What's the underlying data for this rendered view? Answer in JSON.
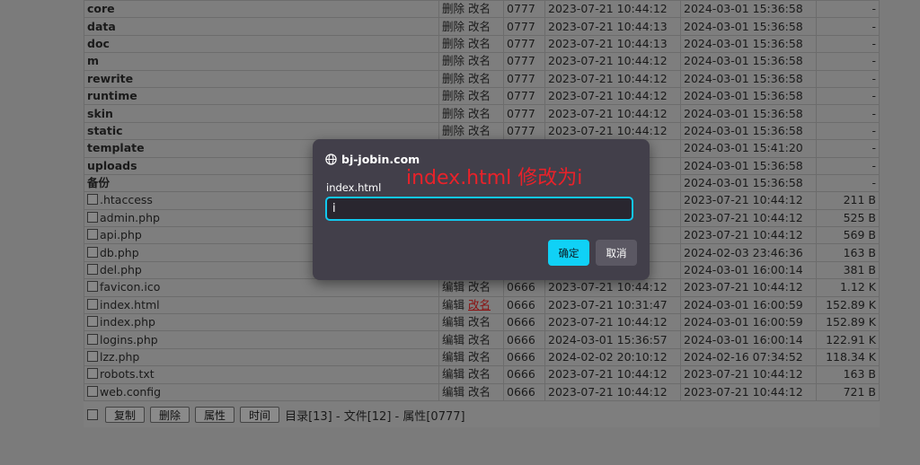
{
  "file_list": {
    "rows": [
      {
        "name": "core",
        "is_dir": true,
        "actions": [
          "删除",
          "改名"
        ],
        "perm": "0777",
        "created": "2023-07-21 10:44:12",
        "modified": "2024-03-01 15:36:58",
        "size": "-"
      },
      {
        "name": "data",
        "is_dir": true,
        "actions": [
          "删除",
          "改名"
        ],
        "perm": "0777",
        "created": "2023-07-21 10:44:13",
        "modified": "2024-03-01 15:36:58",
        "size": "-"
      },
      {
        "name": "doc",
        "is_dir": true,
        "actions": [
          "删除",
          "改名"
        ],
        "perm": "0777",
        "created": "2023-07-21 10:44:13",
        "modified": "2024-03-01 15:36:58",
        "size": "-"
      },
      {
        "name": "m",
        "is_dir": true,
        "actions": [
          "删除",
          "改名"
        ],
        "perm": "0777",
        "created": "2023-07-21 10:44:12",
        "modified": "2024-03-01 15:36:58",
        "size": "-"
      },
      {
        "name": "rewrite",
        "is_dir": true,
        "actions": [
          "删除",
          "改名"
        ],
        "perm": "0777",
        "created": "2023-07-21 10:44:12",
        "modified": "2024-03-01 15:36:58",
        "size": "-"
      },
      {
        "name": "runtime",
        "is_dir": true,
        "actions": [
          "删除",
          "改名"
        ],
        "perm": "0777",
        "created": "2023-07-21 10:44:12",
        "modified": "2024-03-01 15:36:58",
        "size": "-"
      },
      {
        "name": "skin",
        "is_dir": true,
        "actions": [
          "删除",
          "改名"
        ],
        "perm": "0777",
        "created": "2023-07-21 10:44:12",
        "modified": "2024-03-01 15:36:58",
        "size": "-"
      },
      {
        "name": "static",
        "is_dir": true,
        "actions": [
          "删除",
          "改名"
        ],
        "perm": "0777",
        "created": "2023-07-21 10:44:12",
        "modified": "2024-03-01 15:36:58",
        "size": "-"
      },
      {
        "name": "template",
        "is_dir": true,
        "actions": [
          "",
          ""
        ],
        "perm": "",
        "created": "",
        "modified": "2024-03-01 15:41:20",
        "size": "-"
      },
      {
        "name": "uploads",
        "is_dir": true,
        "actions": [
          "",
          ""
        ],
        "perm": "",
        "created": "",
        "modified": "2024-03-01 15:36:58",
        "size": "-"
      },
      {
        "name": "备份",
        "is_dir": true,
        "actions": [
          "",
          ""
        ],
        "perm": "",
        "created": "",
        "modified": "2024-03-01 15:36:58",
        "size": "-"
      },
      {
        "name": ".htaccess",
        "is_dir": false,
        "actions": [
          "",
          ""
        ],
        "perm": "",
        "created": "",
        "modified": "2023-07-21 10:44:12",
        "size": "211 B"
      },
      {
        "name": "admin.php",
        "is_dir": false,
        "actions": [
          "",
          ""
        ],
        "perm": "",
        "created": "",
        "modified": "2023-07-21 10:44:12",
        "size": "525 B"
      },
      {
        "name": "api.php",
        "is_dir": false,
        "actions": [
          "",
          ""
        ],
        "perm": "",
        "created": "",
        "modified": "2023-07-21 10:44:12",
        "size": "569 B"
      },
      {
        "name": "db.php",
        "is_dir": false,
        "actions": [
          "",
          ""
        ],
        "perm": "",
        "created": "",
        "modified": "2024-02-03 23:46:36",
        "size": "163 B"
      },
      {
        "name": "del.php",
        "is_dir": false,
        "actions": [
          "",
          ""
        ],
        "perm": "",
        "created": "",
        "modified": "2024-03-01 16:00:14",
        "size": "381 B"
      },
      {
        "name": "favicon.ico",
        "is_dir": false,
        "actions": [
          "编辑",
          "改名"
        ],
        "perm": "0666",
        "created": "2023-07-21 10:44:12",
        "modified": "2023-07-21 10:44:12",
        "size": "1.12 K"
      },
      {
        "name": "index.html",
        "is_dir": false,
        "actions": [
          "编辑",
          "改名"
        ],
        "perm": "0666",
        "created": "2023-07-21 10:31:47",
        "modified": "2024-03-01 16:00:59",
        "size": "152.89 K",
        "highlight": true
      },
      {
        "name": "index.php",
        "is_dir": false,
        "actions": [
          "编辑",
          "改名"
        ],
        "perm": "0666",
        "created": "2023-07-21 10:44:12",
        "modified": "2024-03-01 16:00:59",
        "size": "152.89 K"
      },
      {
        "name": "logins.php",
        "is_dir": false,
        "actions": [
          "编辑",
          "改名"
        ],
        "perm": "0666",
        "created": "2024-03-01 15:36:57",
        "modified": "2024-03-01 16:00:14",
        "size": "122.91 K"
      },
      {
        "name": "lzz.php",
        "is_dir": false,
        "actions": [
          "编辑",
          "改名"
        ],
        "perm": "0666",
        "created": "2024-02-02 20:10:12",
        "modified": "2024-02-16 07:34:52",
        "size": "118.34 K"
      },
      {
        "name": "robots.txt",
        "is_dir": false,
        "actions": [
          "编辑",
          "改名"
        ],
        "perm": "0666",
        "created": "2023-07-21 10:44:12",
        "modified": "2023-07-21 10:44:12",
        "size": "163 B"
      },
      {
        "name": "web.config",
        "is_dir": false,
        "actions": [
          "编辑",
          "改名"
        ],
        "perm": "0666",
        "created": "2023-07-21 10:44:12",
        "modified": "2023-07-21 10:44:12",
        "size": "721 B"
      }
    ]
  },
  "bottom_bar": {
    "buttons": [
      "复制",
      "删除",
      "属性",
      "时间"
    ],
    "summary": "目录[13] - 文件[12] - 属性[0777]"
  },
  "dialog": {
    "site": "bj-jobin.com",
    "annotation": "index.html 修改为i",
    "field_label": "index.html",
    "input_value": "i",
    "ok_label": "确定",
    "cancel_label": "取消",
    "accent_color": "#10d1f6"
  }
}
